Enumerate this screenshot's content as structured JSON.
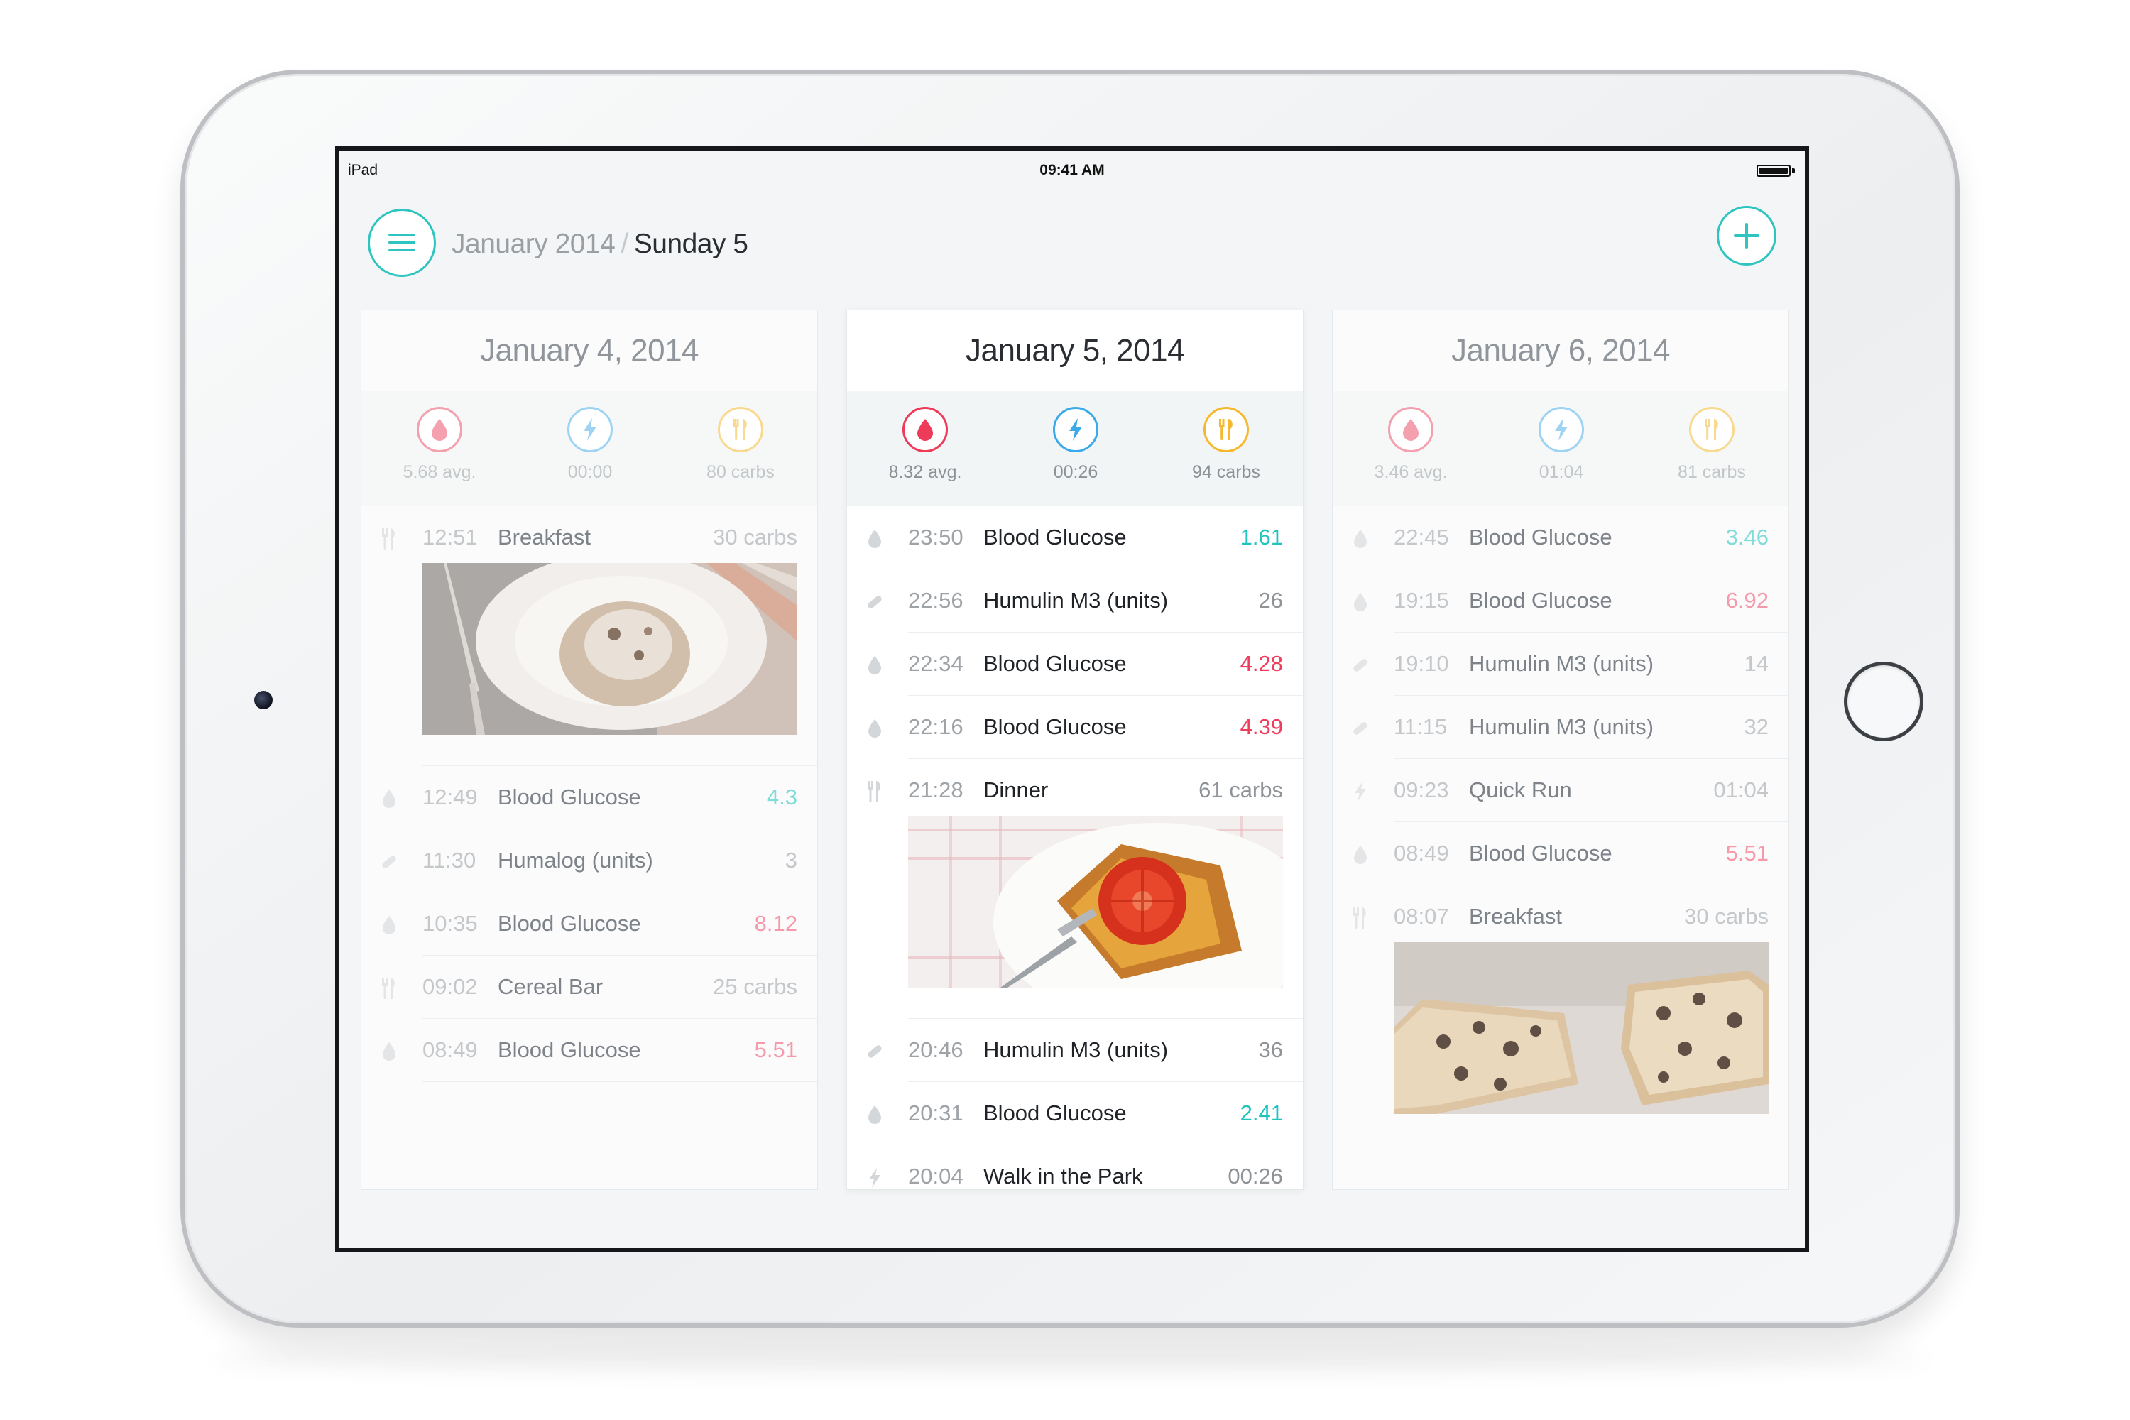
{
  "status_bar": {
    "carrier": "iPad",
    "time": "09:41 AM"
  },
  "header": {
    "month": "January 2014",
    "separator": "/",
    "day": "Sunday 5"
  },
  "columns": [
    {
      "date": "January 4, 2014",
      "active": false,
      "stats": [
        {
          "icon": "blood-drop-icon",
          "value": "5.68 avg."
        },
        {
          "icon": "lightning-icon",
          "value": "00:00"
        },
        {
          "icon": "fork-knife-icon",
          "value": "80 carbs"
        }
      ],
      "entries": [
        {
          "type": "meal",
          "icon": "fork-knife-icon",
          "time": "12:51",
          "label": "Breakfast",
          "value": "30 carbs",
          "photo": "cinnamon-roll-photo"
        },
        {
          "type": "glucose",
          "icon": "blood-drop-icon",
          "time": "12:49",
          "label": "Blood Glucose",
          "value": "4.3",
          "tone": "teal"
        },
        {
          "type": "insulin",
          "icon": "pill-icon",
          "time": "11:30",
          "label": "Humalog (units)",
          "value": "3"
        },
        {
          "type": "glucose",
          "icon": "blood-drop-icon",
          "time": "10:35",
          "label": "Blood Glucose",
          "value": "8.12",
          "tone": "pink"
        },
        {
          "type": "snack",
          "icon": "fork-knife-icon",
          "time": "09:02",
          "label": "Cereal Bar",
          "value": "25 carbs"
        },
        {
          "type": "glucose",
          "icon": "blood-drop-icon",
          "time": "08:49",
          "label": "Blood Glucose",
          "value": "5.51",
          "tone": "pink"
        }
      ]
    },
    {
      "date": "January 5, 2014",
      "active": true,
      "stats": [
        {
          "icon": "blood-drop-icon",
          "value": "8.32 avg."
        },
        {
          "icon": "lightning-icon",
          "value": "00:26"
        },
        {
          "icon": "fork-knife-icon",
          "value": "94 carbs"
        }
      ],
      "entries": [
        {
          "type": "glucose",
          "icon": "blood-drop-icon",
          "time": "23:50",
          "label": "Blood Glucose",
          "value": "1.61",
          "tone": "teal"
        },
        {
          "type": "insulin",
          "icon": "pill-icon",
          "time": "22:56",
          "label": "Humulin M3 (units)",
          "value": "26"
        },
        {
          "type": "glucose",
          "icon": "blood-drop-icon",
          "time": "22:34",
          "label": "Blood Glucose",
          "value": "4.28",
          "tone": "pink"
        },
        {
          "type": "glucose",
          "icon": "blood-drop-icon",
          "time": "22:16",
          "label": "Blood Glucose",
          "value": "4.39",
          "tone": "pink"
        },
        {
          "type": "meal",
          "icon": "fork-knife-icon",
          "time": "21:28",
          "label": "Dinner",
          "value": "61 carbs",
          "photo": "lasagna-photo"
        },
        {
          "type": "insulin",
          "icon": "pill-icon",
          "time": "20:46",
          "label": "Humulin M3 (units)",
          "value": "36"
        },
        {
          "type": "glucose",
          "icon": "blood-drop-icon",
          "time": "20:31",
          "label": "Blood Glucose",
          "value": "2.41",
          "tone": "teal"
        },
        {
          "type": "exercise",
          "icon": "lightning-icon",
          "time": "20:04",
          "label": "Walk in the Park",
          "value": "00:26"
        }
      ]
    },
    {
      "date": "January 6, 2014",
      "active": false,
      "stats": [
        {
          "icon": "blood-drop-icon",
          "value": "3.46 avg."
        },
        {
          "icon": "lightning-icon",
          "value": "01:04"
        },
        {
          "icon": "fork-knife-icon",
          "value": "81 carbs"
        }
      ],
      "entries": [
        {
          "type": "glucose",
          "icon": "blood-drop-icon",
          "time": "22:45",
          "label": "Blood Glucose",
          "value": "3.46",
          "tone": "teal"
        },
        {
          "type": "glucose",
          "icon": "blood-drop-icon",
          "time": "19:15",
          "label": "Blood Glucose",
          "value": "6.92",
          "tone": "pink"
        },
        {
          "type": "insulin",
          "icon": "pill-icon",
          "time": "19:10",
          "label": "Humulin M3 (units)",
          "value": "14"
        },
        {
          "type": "insulin",
          "icon": "pill-icon",
          "time": "11:15",
          "label": "Humulin M3 (units)",
          "value": "32"
        },
        {
          "type": "exercise",
          "icon": "lightning-icon",
          "time": "09:23",
          "label": "Quick Run",
          "value": "01:04"
        },
        {
          "type": "glucose",
          "icon": "blood-drop-icon",
          "time": "08:49",
          "label": "Blood Glucose",
          "value": "5.51",
          "tone": "pink"
        },
        {
          "type": "meal",
          "icon": "fork-knife-icon",
          "time": "08:07",
          "label": "Breakfast",
          "value": "30 carbs",
          "photo": "chocolate-chip-bars-photo"
        }
      ]
    }
  ],
  "colors": {
    "accent": "#2ec5c0",
    "glucose": "#ee3b59",
    "exercise": "#3aabe8",
    "food": "#f5b82e",
    "value_low": "#20c4be",
    "value_high": "#ef3d5e"
  }
}
